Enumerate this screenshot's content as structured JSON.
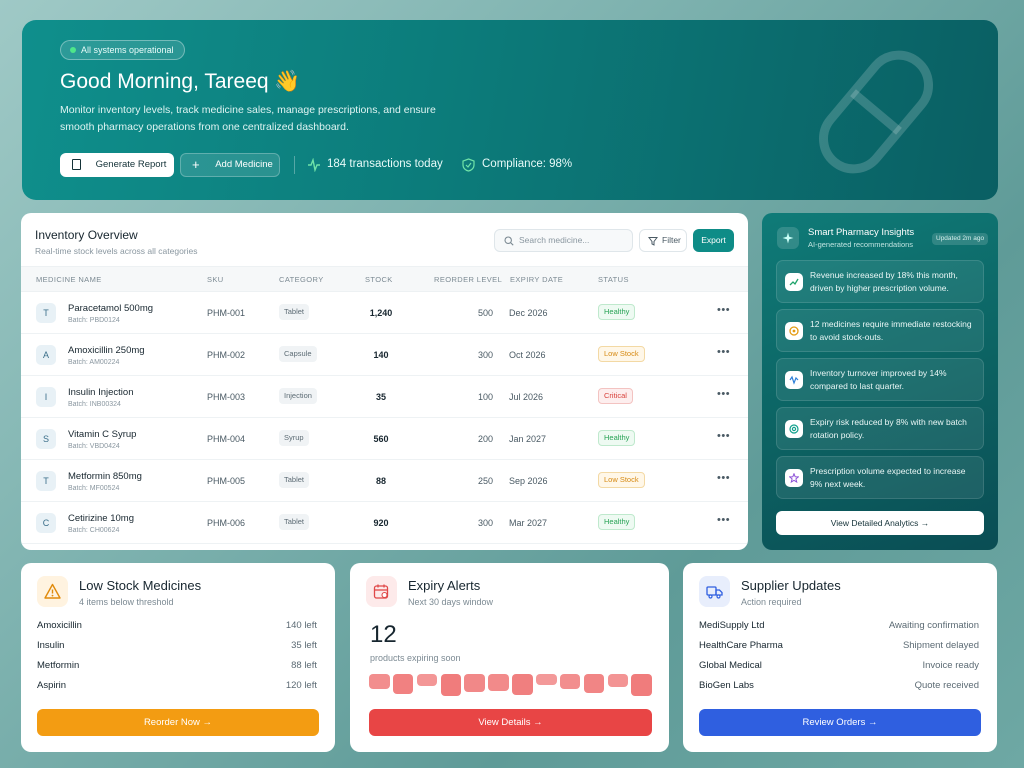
{
  "hero": {
    "status_badge": "All systems operational",
    "greeting": "Good Morning, Tareeq 👋",
    "description": "Monitor inventory levels, track medicine sales, manage prescriptions, and ensure smooth pharmacy operations from one centralized dashboard.",
    "generate_report": "Generate Report",
    "add_medicine": "Add Medicine",
    "transactions": "184 transactions today",
    "compliance": "Compliance: 98%"
  },
  "inventory": {
    "title": "Inventory Overview",
    "subtitle": "Real-time stock levels across all categories",
    "search_placeholder": "Search medicine...",
    "filter": "Filter",
    "export": "Export",
    "columns": [
      "MEDICINE NAME",
      "SKU",
      "CATEGORY",
      "STOCK",
      "REORDER LEVEL",
      "EXPIRY DATE",
      "STATUS"
    ],
    "rows": [
      {
        "initial": "T",
        "name": "Paracetamol 500mg",
        "batch": "Batch: PBD0124",
        "sku": "PHM-001",
        "category": "Tablet",
        "stock": "1,240",
        "reorder": "500",
        "expiry": "Dec 2026",
        "status": "Healthy"
      },
      {
        "initial": "A",
        "name": "Amoxicillin 250mg",
        "batch": "Batch: AM00224",
        "sku": "PHM-002",
        "category": "Capsule",
        "stock": "140",
        "reorder": "300",
        "expiry": "Oct 2026",
        "status": "Low Stock"
      },
      {
        "initial": "I",
        "name": "Insulin Injection",
        "batch": "Batch: INB00324",
        "sku": "PHM-003",
        "category": "Injection",
        "stock": "35",
        "reorder": "100",
        "expiry": "Jul 2026",
        "status": "Critical"
      },
      {
        "initial": "S",
        "name": "Vitamin C Syrup",
        "batch": "Batch: VBD0424",
        "sku": "PHM-004",
        "category": "Syrup",
        "stock": "560",
        "reorder": "200",
        "expiry": "Jan 2027",
        "status": "Healthy"
      },
      {
        "initial": "T",
        "name": "Metformin 850mg",
        "batch": "Batch: MF00524",
        "sku": "PHM-005",
        "category": "Tablet",
        "stock": "88",
        "reorder": "250",
        "expiry": "Sep 2026",
        "status": "Low Stock"
      },
      {
        "initial": "C",
        "name": "Cetirizine 10mg",
        "batch": "Batch: CH00624",
        "sku": "PHM-006",
        "category": "Tablet",
        "stock": "920",
        "reorder": "300",
        "expiry": "Mar 2027",
        "status": "Healthy"
      }
    ]
  },
  "insights": {
    "title": "Smart Pharmacy Insights",
    "subtitle": "AI-generated recommendations",
    "updated": "Updated 2m ago",
    "items": [
      "Revenue increased by 18% this month, driven by higher prescription volume.",
      "12 medicines require immediate restocking to avoid stock-outs.",
      "Inventory turnover improved by 14% compared to last quarter.",
      "Expiry risk reduced by 8% with new batch rotation policy.",
      "Prescription volume expected to increase 9% next week."
    ],
    "cta": "View Detailed Analytics →"
  },
  "low_stock": {
    "title": "Low Stock Medicines",
    "subtitle": "4 items below threshold",
    "items": [
      {
        "name": "Amoxicillin",
        "value": "140 left"
      },
      {
        "name": "Insulin",
        "value": "35 left"
      },
      {
        "name": "Metformin",
        "value": "88 left"
      },
      {
        "name": "Aspirin",
        "value": "120 left"
      }
    ],
    "button": "Reorder Now →",
    "accent": "#f39c12"
  },
  "expiry": {
    "title": "Expiry Alerts",
    "subtitle": "Next 30 days window",
    "count": "12",
    "count_label": "products expiring soon",
    "bar_levels": [
      0.7,
      0.9,
      0.55,
      1.0,
      0.8,
      0.75,
      0.95,
      0.5,
      0.7,
      0.85,
      0.6,
      1.0
    ],
    "button": "View Details →",
    "accent": "#e84545"
  },
  "supplier": {
    "title": "Supplier Updates",
    "subtitle": "Action required",
    "items": [
      {
        "name": "MediSupply Ltd",
        "value": "Awaiting confirmation"
      },
      {
        "name": "HealthCare Pharma",
        "value": "Shipment delayed"
      },
      {
        "name": "Global Medical",
        "value": "Invoice ready"
      },
      {
        "name": "BioGen Labs",
        "value": "Quote received"
      }
    ],
    "button": "Review Orders →",
    "accent": "#2f5fe0"
  }
}
